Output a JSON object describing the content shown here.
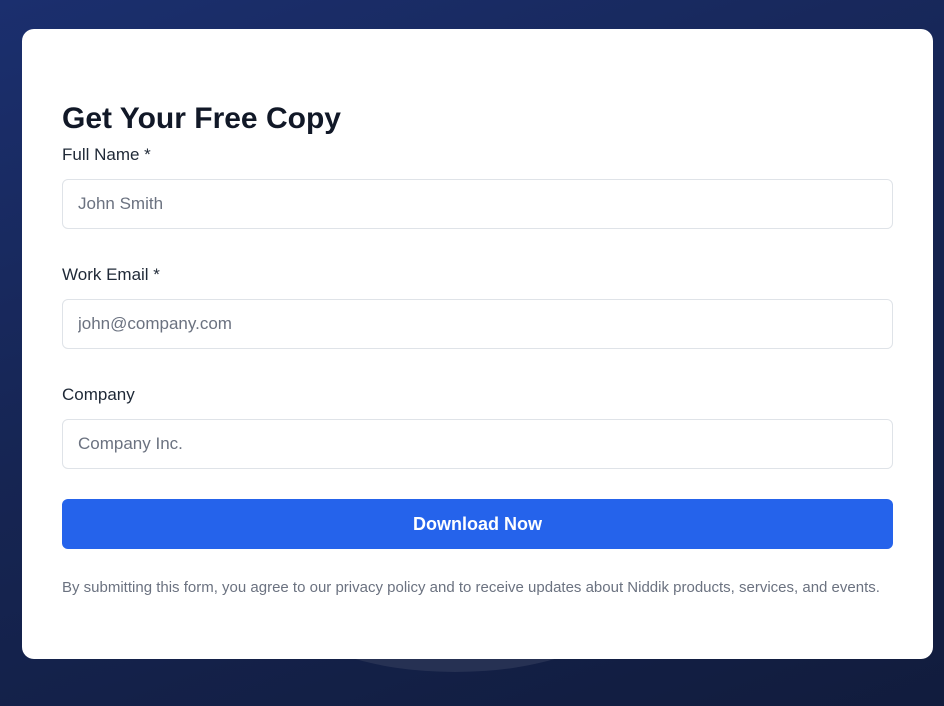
{
  "form": {
    "title": "Get Your Free Copy",
    "fields": [
      {
        "label": "Full Name *",
        "placeholder": "John Smith",
        "value": ""
      },
      {
        "label": "Work Email *",
        "placeholder": "john@company.com",
        "value": ""
      },
      {
        "label": "Company",
        "placeholder": "Company Inc.",
        "value": ""
      }
    ],
    "submit_label": "Download Now",
    "disclaimer": "By submitting this form, you agree to our privacy policy and to receive updates about Niddik products, services, and events."
  },
  "colors": {
    "background": "#162553",
    "card": "#ffffff",
    "primary_button": "#2563eb",
    "title_text": "#111827",
    "muted_text": "#6b7280"
  }
}
